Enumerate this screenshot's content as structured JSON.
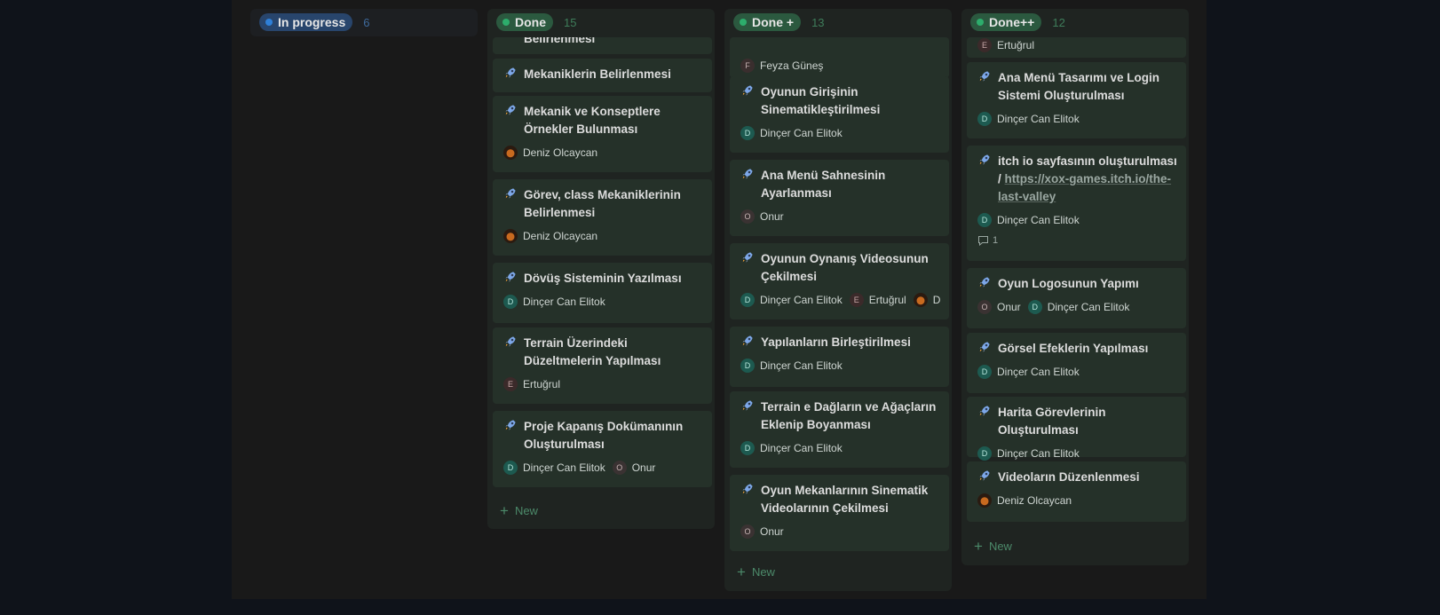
{
  "columns": [
    {
      "label": "In progress",
      "count": "6"
    },
    {
      "label": "Done",
      "count": "15",
      "new_label": "New",
      "cards": [
        {
          "title": "Belirlenmesi",
          "people": []
        },
        {
          "title": "Mekaniklerin Belirlenmesi",
          "people": []
        },
        {
          "title": "Mekanik ve Konseptlere Örnekler Bulunması",
          "people": [
            {
              "initial": "",
              "name": "Deniz Olcaycan",
              "avatar": "photo"
            }
          ]
        },
        {
          "title": "Görev, class Mekaniklerinin Belirlenmesi",
          "people": [
            {
              "initial": "",
              "name": "Deniz Olcaycan",
              "avatar": "photo"
            }
          ]
        },
        {
          "title": "Dövüş Sisteminin Yazılması",
          "people": [
            {
              "initial": "D",
              "name": "Dinçer Can Elitok"
            }
          ]
        },
        {
          "title": "Terrain Üzerindeki Düzeltmelerin Yapılması",
          "people": [
            {
              "initial": "E",
              "name": "Ertuğrul"
            }
          ]
        },
        {
          "title": "Proje Kapanış Dokümanının Oluşturulması",
          "people": [
            {
              "initial": "D",
              "name": "Dinçer Can Elitok"
            },
            {
              "initial": "O",
              "name": "Onur"
            }
          ]
        }
      ]
    },
    {
      "label": "Done +",
      "count": "13",
      "new_label": "New",
      "cards": [
        {
          "title": "",
          "people": [
            {
              "initial": "F",
              "name": "Feyza Güneş"
            }
          ]
        },
        {
          "title": "Oyunun Girişinin Sinematikleştirilmesi",
          "people": [
            {
              "initial": "D",
              "name": "Dinçer Can Elitok"
            }
          ]
        },
        {
          "title": "Ana Menü Sahnesinin Ayarlanması",
          "people": [
            {
              "initial": "O",
              "name": "Onur"
            }
          ]
        },
        {
          "title": "Oyunun Oynanış Videosunun Çekilmesi",
          "people": [
            {
              "initial": "D",
              "name": "Dinçer Can Elitok"
            },
            {
              "initial": "E",
              "name": "Ertuğrul"
            },
            {
              "initial": "",
              "name": "Deniz C",
              "avatar": "photo"
            }
          ]
        },
        {
          "title": "Yapılanların Birleştirilmesi",
          "people": [
            {
              "initial": "D",
              "name": "Dinçer Can Elitok"
            }
          ]
        },
        {
          "title": "Terrain e Dağların ve Ağaçların Eklenip Boyanması",
          "people": [
            {
              "initial": "D",
              "name": "Dinçer Can Elitok"
            }
          ]
        },
        {
          "title": "Oyun Mekanlarının Sinematik Videolarının Çekilmesi",
          "people": [
            {
              "initial": "O",
              "name": "Onur"
            }
          ]
        }
      ]
    },
    {
      "label": "Done++",
      "count": "12",
      "new_label": "New",
      "cards": [
        {
          "title": "",
          "people": [
            {
              "initial": "E",
              "name": "Ertuğrul"
            }
          ]
        },
        {
          "title": "Ana Menü Tasarımı ve Login Sistemi Oluşturulması",
          "people": [
            {
              "initial": "D",
              "name": "Dinçer Can Elitok"
            }
          ]
        },
        {
          "title": "itch io sayfasının oluşturulması /",
          "link": "https://xox-games.itch.io/the-last-valley",
          "people": [
            {
              "initial": "D",
              "name": "Dinçer Can Elitok"
            }
          ],
          "comments": "1"
        },
        {
          "title": "Oyun Logosunun Yapımı",
          "people": [
            {
              "initial": "O",
              "name": "Onur"
            },
            {
              "initial": "D",
              "name": "Dinçer Can Elitok"
            }
          ]
        },
        {
          "title": "Görsel Efeklerin Yapılması",
          "people": [
            {
              "initial": "D",
              "name": "Dinçer Can Elitok"
            }
          ]
        },
        {
          "title": "Harita Görevlerinin Oluşturulması",
          "people": [
            {
              "initial": "D",
              "name": "Dinçer Can Elitok"
            }
          ]
        },
        {
          "title": "Videoların Düzenlenmesi",
          "people": [
            {
              "initial": "",
              "name": "Deniz Olcaycan",
              "avatar": "photo"
            }
          ]
        }
      ]
    }
  ],
  "colors": {
    "in_progress_pill": "#28456c",
    "in_progress_dot": "#2f80d8",
    "in_progress_count": "#3e6a9c",
    "done_pill": "#2b593f",
    "done_dot": "#2dad6c",
    "done_count": "#3e7d5a",
    "done_col_bg": "#1f2421",
    "card_bg": "#253129"
  }
}
